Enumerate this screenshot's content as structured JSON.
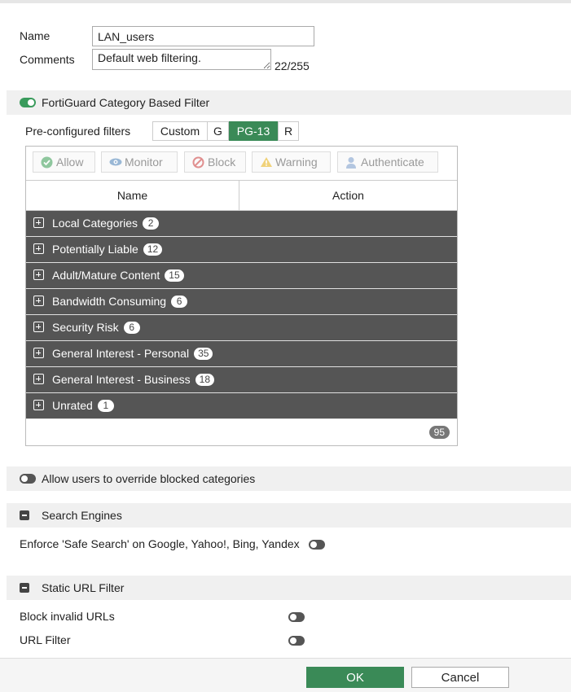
{
  "form": {
    "name_label": "Name",
    "name_value": "LAN_users",
    "comments_label": "Comments",
    "comments_value": "Default web filtering.",
    "char_count": "22/255"
  },
  "fortiguard": {
    "title": "FortiGuard Category Based Filter",
    "enabled": true,
    "preconfig_label": "Pre-configured filters",
    "filters": [
      "Custom",
      "G",
      "PG-13",
      "R"
    ],
    "selected_filter": "PG-13",
    "toolbar": {
      "allow": "Allow",
      "monitor": "Monitor",
      "block": "Block",
      "warning": "Warning",
      "authenticate": "Authenticate"
    },
    "columns": [
      "Name",
      "Action"
    ],
    "categories": [
      {
        "name": "Local Categories",
        "count": "2"
      },
      {
        "name": "Potentially Liable",
        "count": "12"
      },
      {
        "name": "Adult/Mature Content",
        "count": "15"
      },
      {
        "name": "Bandwidth Consuming",
        "count": "6"
      },
      {
        "name": "Security Risk",
        "count": "6"
      },
      {
        "name": "General Interest - Personal",
        "count": "35"
      },
      {
        "name": "General Interest - Business",
        "count": "18"
      },
      {
        "name": "Unrated",
        "count": "1"
      }
    ],
    "total": "95"
  },
  "override": {
    "label": "Allow users to override blocked categories",
    "enabled": false
  },
  "search_engines": {
    "title": "Search Engines",
    "safe_search_label": "Enforce 'Safe Search' on Google, Yahoo!, Bing, Yandex",
    "safe_search_enabled": false
  },
  "static_url": {
    "title": "Static URL Filter",
    "block_invalid_label": "Block invalid URLs",
    "url_filter_label": "URL Filter"
  },
  "buttons": {
    "ok": "OK",
    "cancel": "Cancel"
  },
  "colors": {
    "accent_green": "#3a8a57",
    "row_dark": "#555555"
  }
}
